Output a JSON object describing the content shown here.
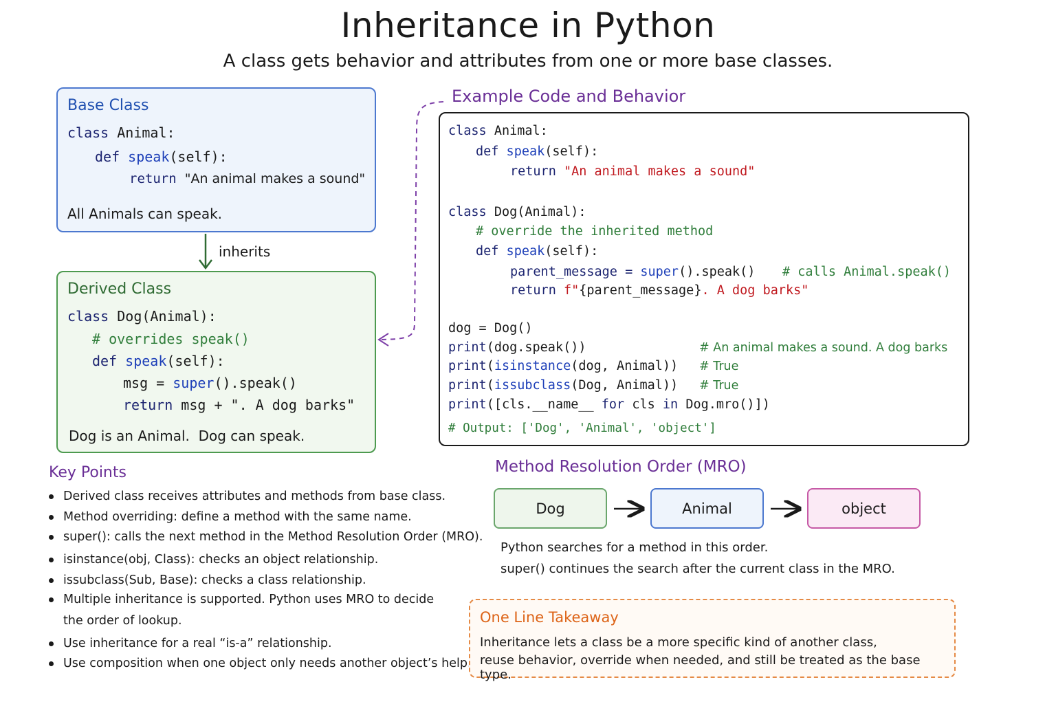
{
  "title": "Inheritance in Python",
  "subtitle": "A class gets behavior and attributes from one or more base classes.",
  "base_class": {
    "heading": "Base Class",
    "code": {
      "l1_kw": "class",
      "l1_rest": " Animal:",
      "l2_kw": "def",
      "l2_fn": " speak",
      "l2_rest": "(self):",
      "l3_kw": "return",
      "l3_str": "  \"An animal makes a sound\""
    },
    "note": "All Animals can speak."
  },
  "inherits_label": "inherits",
  "derived_class": {
    "heading": "Derived Class",
    "code": {
      "l1_kw": "class",
      "l1_rest": " Dog(Animal):",
      "l2_cm": "# overrides speak()",
      "l3_kw": "def",
      "l3_fn": " speak",
      "l3_rest": "(self):",
      "l4_a": "msg = ",
      "l4_fn": "super",
      "l4_b": "().speak()",
      "l5_kw": "return",
      "l5_rest": " msg + \". A dog barks\""
    },
    "note": "Dog is an Animal.  Dog can speak."
  },
  "example": {
    "title": "Example Code and Behavior",
    "c1_kw": "class",
    "c1_rest": " Animal:",
    "c2_kw": "def",
    "c2_fn": " speak",
    "c2_rest": "(self):",
    "c3_kw": "return",
    "c3_str": " \"An animal makes a sound\"",
    "c4_kw": "class",
    "c4_rest": " Dog(Animal):",
    "c5_cm": "# override the inherited method",
    "c6_kw": "def",
    "c6_fn": " speak",
    "c6_rest": "(self):",
    "c7_a": "parent_message = ",
    "c7_fn": "super",
    "c7_b": "().speak()",
    "c7_cm": "# calls Animal.speak()",
    "c8_kw": "return",
    "c8_str1": " f\"",
    "c8_mid": "{parent_message}",
    "c8_str2": ". A dog barks\"",
    "c9": "dog = Dog()",
    "c10_fn": "print",
    "c10_rest": "(dog.speak())",
    "c10_cm": "# An animal makes a sound. A dog barks",
    "c11_fn": "print",
    "c11_a": "(",
    "c11_fn2": "isinstance",
    "c11_b": "(dog, Animal))",
    "c11_cm": "# True",
    "c12_fn": "print",
    "c12_a": "(",
    "c12_fn2": "issubclass",
    "c12_b": "(Dog, Animal))",
    "c12_cm": "# True",
    "c13_fn": "print",
    "c13_a": "([cls.__name__ ",
    "c13_kw": "for",
    "c13_b": " cls ",
    "c13_kw2": "in",
    "c13_c": " Dog.mro()])",
    "c14_cm": "# Output: ['Dog', 'Animal', 'object']"
  },
  "key_points": {
    "title": "Key Points",
    "items": [
      "Derived class receives attributes and methods from base class.",
      "Method overriding: define a method with the same name.",
      "super(): calls the next method in the Method Resolution Order (MRO).",
      "isinstance(obj, Class): checks an object relationship.",
      "issubclass(Sub, Base): checks a class relationship.",
      "Multiple inheritance is supported. Python uses MRO to decide",
      "Use inheritance for a real “is-a” relationship.",
      "Use composition when one object only needs another object’s help."
    ],
    "continuation": "the order of lookup."
  },
  "mro": {
    "title": "Method Resolution Order (MRO)",
    "boxes": [
      "Dog",
      "Animal",
      "object"
    ],
    "note1": "Python searches for a method in this order.",
    "note2": "super() continues the search after the current class in the MRO."
  },
  "takeaway": {
    "title": "One Line Takeaway",
    "line1": "Inheritance lets a class be a more specific kind of another class,",
    "line2": "reuse behavior, override when needed, and still be treated as the base type."
  },
  "colors": {
    "base_border": "#4c78cf",
    "derived_border": "#4d9a4f",
    "accent_purple": "#6a2f96",
    "takeaway_orange": "#dd6418",
    "keyword": "#1c2470",
    "string": "#c0191f",
    "comment": "#2f7d3a"
  }
}
